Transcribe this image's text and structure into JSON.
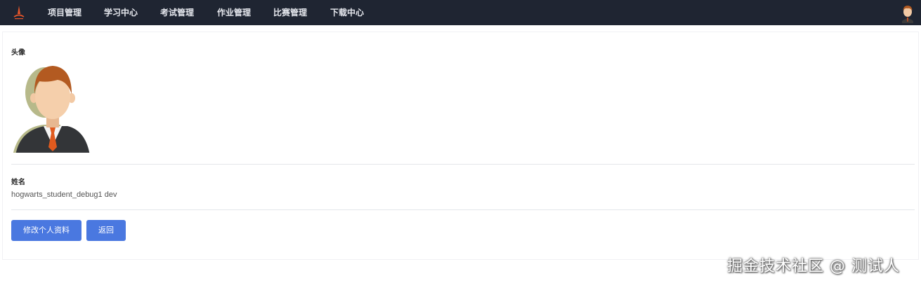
{
  "nav": {
    "items": [
      {
        "label": "项目管理"
      },
      {
        "label": "学习中心"
      },
      {
        "label": "考试管理"
      },
      {
        "label": "作业管理"
      },
      {
        "label": "比赛管理"
      },
      {
        "label": "下载中心"
      }
    ],
    "background": "#1f2532"
  },
  "profile": {
    "avatar_label": "头像",
    "name_label": "姓名",
    "name_value": "hogwarts_student_debug1 dev"
  },
  "actions": {
    "edit_label": "修改个人资料",
    "back_label": "返回",
    "accent": "#4a78e0"
  },
  "watermark": "掘金技术社区 @ 测试人"
}
